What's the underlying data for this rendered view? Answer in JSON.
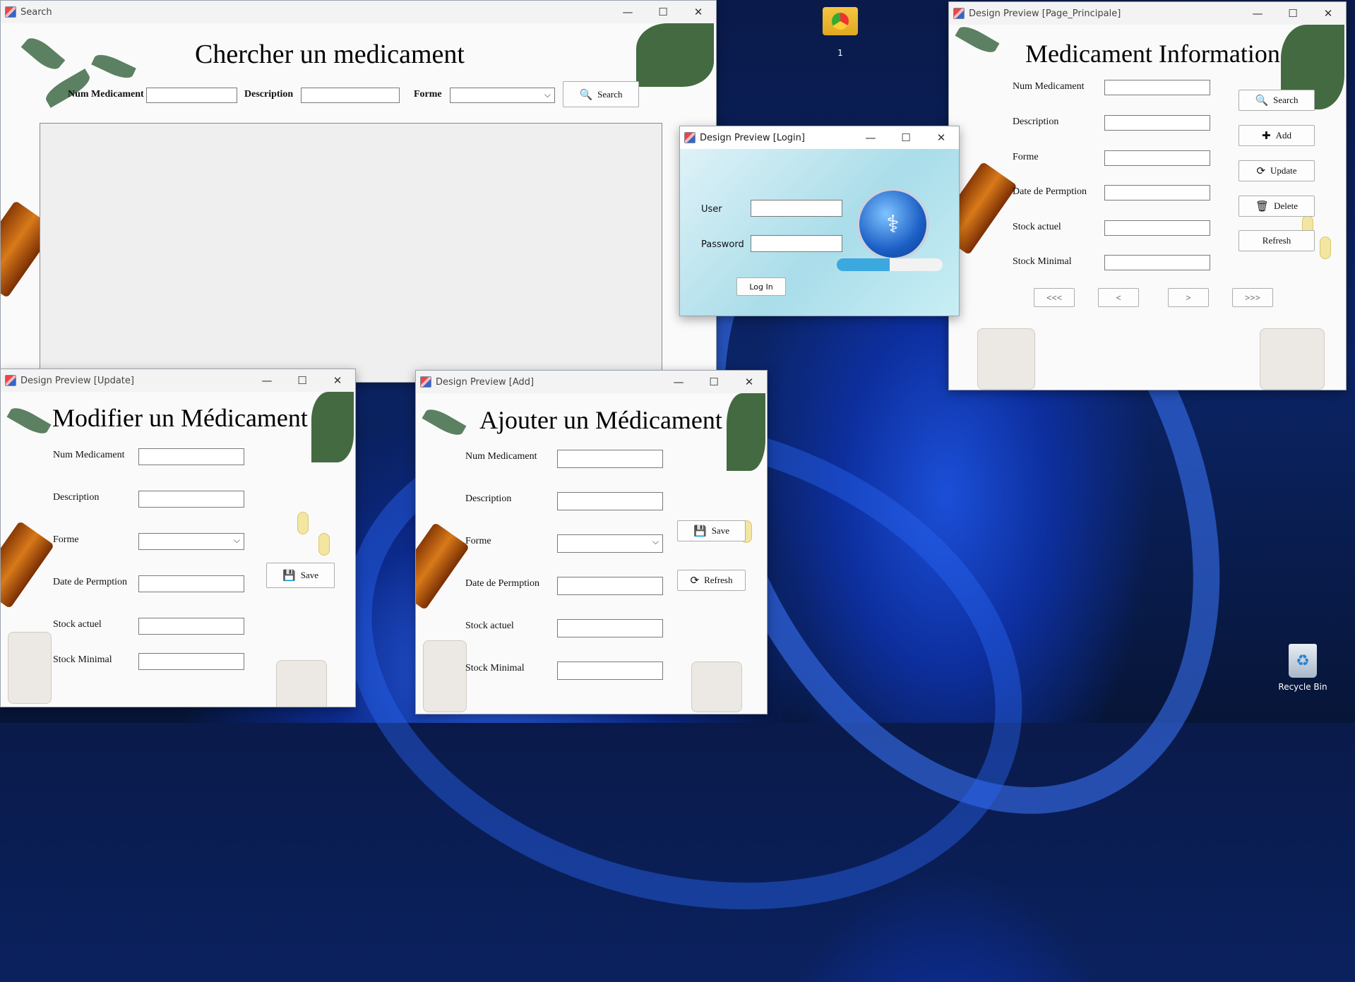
{
  "search_window": {
    "title": "Search",
    "heading": "Chercher un medicament",
    "num_label": "Num Medicament",
    "desc_label": "Description",
    "forme_label": "Forme",
    "search_button": "Search",
    "num_value": "",
    "desc_value": "",
    "forme_value": ""
  },
  "login_window": {
    "title": "Design Preview [Login]",
    "user_label": "User",
    "password_label": "Password",
    "login_button": "Log In",
    "user_value": "",
    "password_value": ""
  },
  "principal_window": {
    "title": "Design Preview [Page_Principale]",
    "heading": "Medicament Information",
    "labels": {
      "num": "Num Medicament",
      "desc": "Description",
      "forme": "Forme",
      "date": "Date de Permption",
      "stock": "Stock actuel",
      "min": "Stock Minimal"
    },
    "buttons": {
      "search": "Search",
      "add": "Add",
      "update": "Update",
      "delete": "Delete",
      "refresh": "Refresh"
    },
    "nav": {
      "first": "<<<",
      "prev": "<",
      "next": ">",
      "last": ">>>"
    }
  },
  "update_window": {
    "title": "Design Preview [Update]",
    "heading": "Modifier un Médicament",
    "labels": {
      "num": "Num Medicament",
      "desc": "Description",
      "forme": "Forme",
      "date": "Date de Permption",
      "stock": "Stock actuel",
      "min": "Stock Minimal"
    },
    "save_button": "Save"
  },
  "add_window": {
    "title": "Design Preview [Add]",
    "heading": "Ajouter un Médicament",
    "labels": {
      "num": "Num Medicament",
      "desc": "Description",
      "forme": "Forme",
      "date": "Date de Permption",
      "stock": "Stock actuel",
      "min": "Stock Minimal"
    },
    "save_button": "Save",
    "refresh_button": "Refresh"
  },
  "desktop": {
    "folder_label": "1",
    "recycle_label": "Recycle Bin"
  },
  "icons": {
    "window": "java-cup-icon",
    "minimize": "minimize-icon",
    "maximize": "maximize-icon",
    "close": "close-icon"
  },
  "colors": {
    "accent_blue": "#1b4fd8",
    "window_bg": "#fbfafa"
  }
}
